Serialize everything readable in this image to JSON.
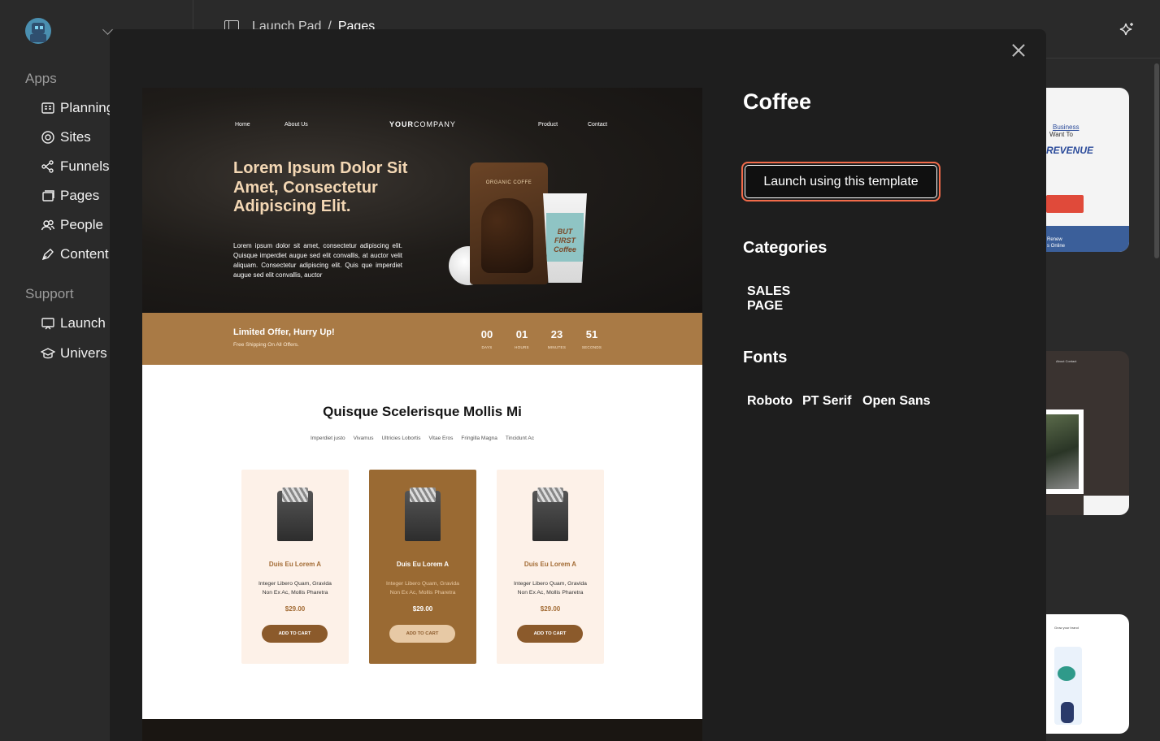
{
  "app": {
    "sections": {
      "apps": "Apps",
      "support": "Support"
    },
    "nav": [
      {
        "id": "planning",
        "label": "Planning",
        "icon": "planning-icon"
      },
      {
        "id": "sites",
        "label": "Sites",
        "icon": "globe-icon"
      },
      {
        "id": "funnels",
        "label": "Funnels",
        "icon": "funnel-icon"
      },
      {
        "id": "pages",
        "label": "Pages",
        "icon": "pages-icon"
      },
      {
        "id": "people",
        "label": "People",
        "icon": "people-icon"
      },
      {
        "id": "content",
        "label": "Content",
        "icon": "pen-icon"
      }
    ],
    "support_nav": [
      {
        "id": "launch",
        "label": "Launch",
        "icon": "presentation-icon"
      },
      {
        "id": "university",
        "label": "Univers",
        "icon": "graduation-cap-icon"
      }
    ]
  },
  "breadcrumb": {
    "parent": "Launch Pad",
    "separator": "/",
    "current": "Pages"
  },
  "modal": {
    "title": "Coffee",
    "launch_label": "Launch using this template",
    "categories_heading": "Categories",
    "categories": [
      "SALES PAGE"
    ],
    "fonts_heading": "Fonts",
    "fonts": [
      "Roboto",
      "PT Serif",
      "Open Sans"
    ],
    "accent_color": "#f26b4a"
  },
  "preview": {
    "nav": {
      "home": "Home",
      "about": "About Us",
      "brand_bold": "YOUR",
      "brand_rest": "COMPANY",
      "product": "Product",
      "contact": "Contact"
    },
    "hero_title": "Lorem Ipsum Dolor Sit Amet, Consectetur Adipiscing Elit.",
    "hero_text": "Lorem ipsum dolor sit amet, consectetur adipiscing elit. Quisque imperdiet augue sed elit convallis, at auctor velit aliquam. Consectetur adipiscing elit. Quis que imperdiet augue sed elit convallis, auctor",
    "bag_label": "ORGANIC COFFE",
    "cup_text": "BUT FIRST Coffee",
    "offer": {
      "title": "Limited Offer, Hurry Up!",
      "subtitle": "Free Shipping On All Offers.",
      "countdown": [
        {
          "value": "00",
          "label": "DAYS"
        },
        {
          "value": "01",
          "label": "HOURS"
        },
        {
          "value": "23",
          "label": "MINUTES"
        },
        {
          "value": "51",
          "label": "SECONDS"
        }
      ]
    },
    "section_title": "Quisque Scelerisque Mollis Mi",
    "tags": [
      "Imperdiet justo",
      "Vivamus",
      "Ultricies Lobortis",
      "Vitae Eros",
      "Fringilla Magna",
      "Tincidunt Ac"
    ],
    "products": [
      {
        "name": "Duis Eu Lorem A",
        "desc": "Integer Libero Quam, Gravida Non Ex Ac, Mollis Pharetra",
        "price": "$29.00",
        "cta": "ADD TO CART",
        "style": "light"
      },
      {
        "name": "Duis Eu Lorem A",
        "desc": "Integer Libero Quam, Gravida Non Ex Ac, Mollis Pharetra",
        "price": "$29.00",
        "cta": "ADD TO CART",
        "style": "dark"
      },
      {
        "name": "Duis Eu Lorem A",
        "desc": "Integer Libero Quam, Gravida Non Ex Ac, Mollis Pharetra",
        "price": "$29.00",
        "cta": "ADD TO CART",
        "style": "light"
      }
    ]
  },
  "bg_cards": [
    {
      "line1": "Business",
      "line2": "Want To",
      "line3": "REVENUE",
      "cta": "Renew",
      "footer": "s Online"
    },
    {
      "nav": "About  Contact"
    },
    {
      "text": "Grow your brand"
    }
  ]
}
